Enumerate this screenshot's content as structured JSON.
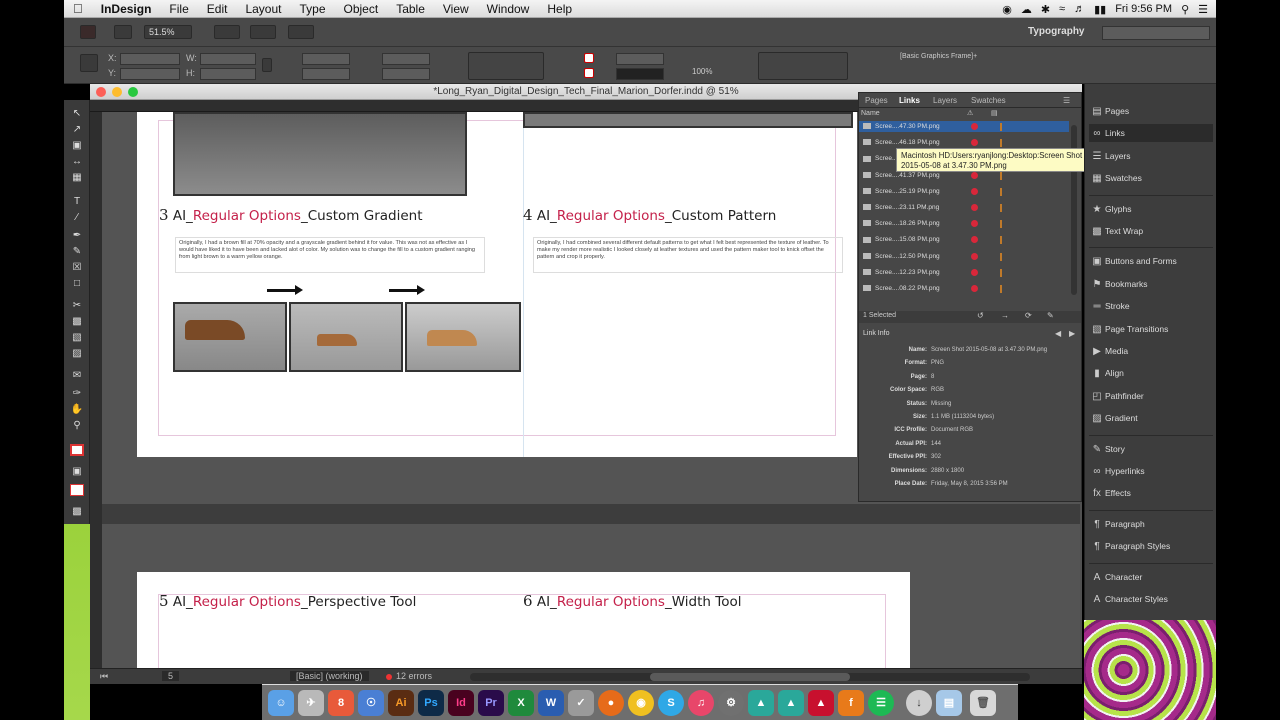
{
  "menubar": {
    "app": "InDesign",
    "items": [
      "File",
      "Edit",
      "Layout",
      "Type",
      "Object",
      "Table",
      "View",
      "Window",
      "Help"
    ],
    "clock": "Fri 9:56 PM"
  },
  "controlbar": {
    "zoom": "51.5%",
    "workspace": "Typography",
    "percent_field": "100%",
    "frame_style": "[Basic Graphics Frame]+"
  },
  "document": {
    "title": "*Long_Ryan_Digital_Design_Tech_Final_Marion_Dorfer.indd @ 51%",
    "sections": [
      {
        "num": "3",
        "prefix": "AI_",
        "red": "Regular Options",
        "suffix": "_Custom Gradient",
        "text": "Originally, I had a brown fill at 70% opacity and a grayscale gradient behind it for value. This was not as effective as I would have liked it to have been and lacked alot of color. My solution was to change the fill to a custom gradient ranging from light brown to a warm yellow orange."
      },
      {
        "num": "4",
        "prefix": "AI_",
        "red": "Regular Options",
        "suffix": "_Custom Pattern",
        "text": "Originally, I had combined several different default patterns to get what I felt best represented the texture of leather. To make my render more realistic I looked closely at leather textures and used the pattern maker tool to knick offset the pattern and crop it properly."
      },
      {
        "num": "5",
        "prefix": "AI_",
        "red": "Regular Options",
        "suffix": "_Perspective Tool"
      },
      {
        "num": "6",
        "prefix": "AI_",
        "red": "Regular Options",
        "suffix": "_Width Tool"
      }
    ]
  },
  "statusbar": {
    "page": "5",
    "profile": "[Basic] (working)",
    "errors": "12 errors"
  },
  "links_panel": {
    "tabs": [
      "Pages",
      "Links",
      "Layers",
      "Swatches"
    ],
    "column_name": "Name",
    "rows": [
      "Scree....47.30 PM.png",
      "Scree....46.18 PM.png",
      "Scree....44.55 PM.png",
      "Scree....41.37 PM.png",
      "Scree....25.19 PM.png",
      "Scree....23.11 PM.png",
      "Scree....18.26 PM.png",
      "Scree....15.08 PM.png",
      "Scree....12.50 PM.png",
      "Scree....12.23 PM.png",
      "Scree....08.22 PM.png"
    ],
    "selected_count": "1 Selected",
    "link_info_title": "Link Info",
    "info": [
      {
        "label": "Name:",
        "value": "Screen Shot 2015-05-08 at 3.47.30 PM.png"
      },
      {
        "label": "Format:",
        "value": "PNG"
      },
      {
        "label": "Page:",
        "value": "8"
      },
      {
        "label": "Color Space:",
        "value": "RGB"
      },
      {
        "label": "Status:",
        "value": "Missing"
      },
      {
        "label": "Size:",
        "value": "1.1 MB (1113204 bytes)"
      },
      {
        "label": "ICC Profile:",
        "value": "Document RGB"
      },
      {
        "label": "Actual PPI:",
        "value": "144"
      },
      {
        "label": "Effective PPI:",
        "value": "302"
      },
      {
        "label": "Dimensions:",
        "value": "2880 x 1800"
      },
      {
        "label": "Place Date:",
        "value": "Friday, May 8, 2015 3:56 PM"
      }
    ]
  },
  "tooltip": {
    "line1": "Macintosh HD:Users:ryanjlong:Desktop:Screen Shot",
    "line2": "2015-05-08 at 3.47.30 PM.png"
  },
  "right_dock": [
    {
      "label": "Pages",
      "icon": "pages-icon"
    },
    {
      "label": "Links",
      "icon": "links-icon"
    },
    {
      "label": "Layers",
      "icon": "layers-icon"
    },
    {
      "label": "Swatches",
      "icon": "swatches-icon"
    },
    {
      "label": "Glyphs",
      "icon": "glyphs-icon"
    },
    {
      "label": "Text Wrap",
      "icon": "text-wrap-icon"
    },
    {
      "label": "Buttons and Forms",
      "icon": "buttons-forms-icon"
    },
    {
      "label": "Bookmarks",
      "icon": "bookmarks-icon"
    },
    {
      "label": "Stroke",
      "icon": "stroke-icon"
    },
    {
      "label": "Page Transitions",
      "icon": "page-transitions-icon"
    },
    {
      "label": "Media",
      "icon": "media-icon"
    },
    {
      "label": "Align",
      "icon": "align-icon"
    },
    {
      "label": "Pathfinder",
      "icon": "pathfinder-icon"
    },
    {
      "label": "Gradient",
      "icon": "gradient-icon"
    },
    {
      "label": "Story",
      "icon": "story-icon"
    },
    {
      "label": "Hyperlinks",
      "icon": "hyperlinks-icon"
    },
    {
      "label": "Effects",
      "icon": "effects-icon"
    },
    {
      "label": "Paragraph",
      "icon": "paragraph-icon"
    },
    {
      "label": "Paragraph Styles",
      "icon": "paragraph-styles-icon"
    },
    {
      "label": "Character",
      "icon": "character-icon"
    },
    {
      "label": "Character Styles",
      "icon": "character-styles-icon"
    }
  ],
  "colors": {
    "accent_red": "#c4214a",
    "panel_bg": "#474747",
    "tooltip_bg": "#fdfbc4"
  }
}
